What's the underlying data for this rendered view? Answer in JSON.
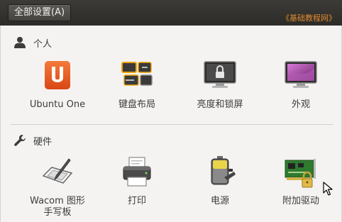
{
  "topbar": {
    "all_settings_label": "全部设置(A)",
    "watermark": "《基础教程网》"
  },
  "sections": {
    "personal": {
      "title": "个人",
      "icon": "person-icon",
      "items": [
        {
          "label": "Ubuntu One",
          "icon": "ubuntu-one-icon",
          "accent": "#e95420"
        },
        {
          "label": "键盘布局",
          "icon": "keyboard-layout-icon",
          "accent": "#f0a30a"
        },
        {
          "label": "亮度和锁屏",
          "icon": "brightness-lock-icon",
          "accent": "#444444"
        },
        {
          "label": "外观",
          "icon": "appearance-icon",
          "accent": "#9b3d9b"
        }
      ]
    },
    "hardware": {
      "title": "硬件",
      "icon": "wrench-icon",
      "items": [
        {
          "label": "Wacom 图形\n手写板",
          "icon": "wacom-tablet-icon"
        },
        {
          "label": "打印",
          "icon": "printer-icon"
        },
        {
          "label": "电源",
          "icon": "power-battery-icon"
        },
        {
          "label": "附加驱动",
          "icon": "additional-drivers-icon",
          "accent": "#2f7a2f"
        }
      ]
    }
  }
}
